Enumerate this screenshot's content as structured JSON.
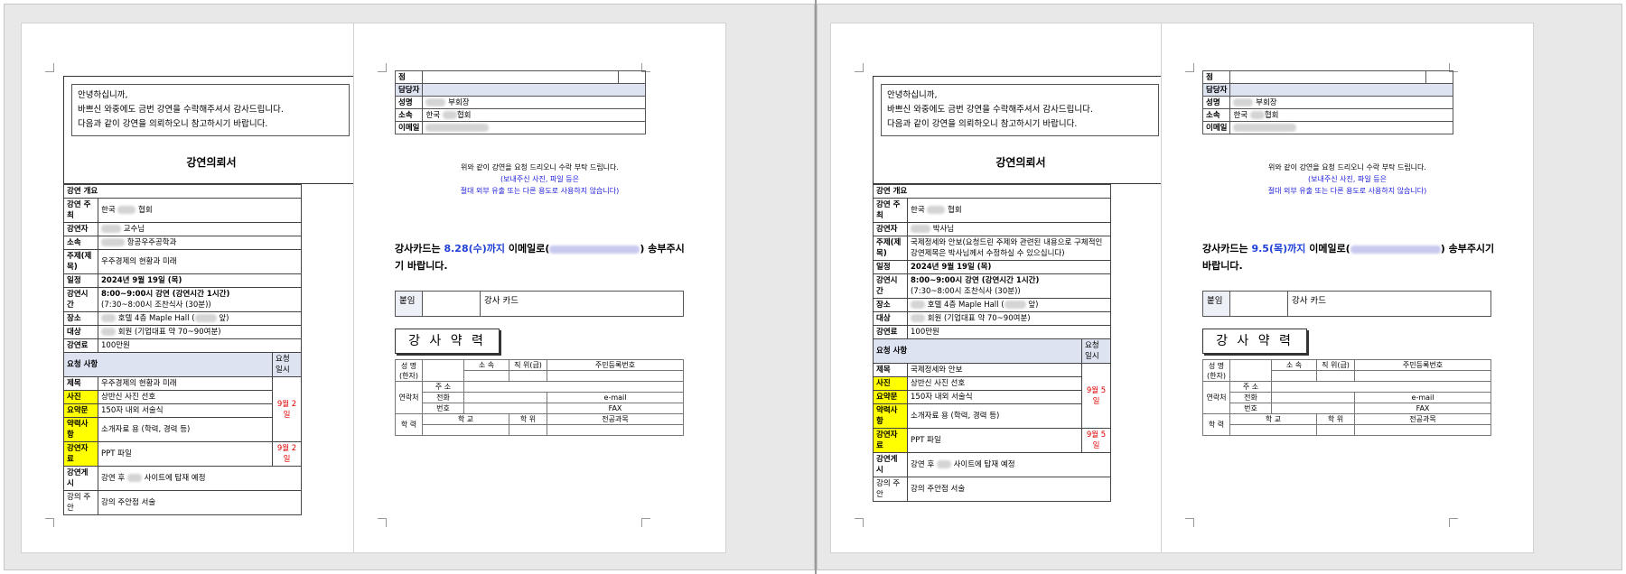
{
  "left_window": {
    "page1": {
      "greeting": [
        "안녕하십니까,",
        "바쁘신 와중에도 금번 강연을 수락해주셔서 감사드립니다.",
        "다음과 같이 강연을 의뢰하오니 참고하시기 바랍니다."
      ],
      "doc_title": "강연의뢰서",
      "overview_label": "강연 개요",
      "host_label": "강연 주최",
      "host_value_prefix": "한국",
      "host_value_suffix": "협회",
      "speaker_label": "강연자",
      "speaker_title": "교수님",
      "affil_label": "소속",
      "affil_value": "항공우주공학과",
      "topic_label": "주제(제목)",
      "topic_value": "우주경제의 현황과 미래",
      "date_label": "일정",
      "date_value": "2024년 9월 19일 (목)",
      "time_label": "강연시간",
      "time_value": "8:00~9:00시 강연 (강연시간 1시간)",
      "time_sub": "(7:30~8:00시 조찬식사 (30분))",
      "place_label": "장소",
      "place_value_a": "호텔 4층 Maple Hall (",
      "place_value_b": "앞)",
      "audience_label": "대상",
      "audience_value": "회원 (기업대표 약 70~90여분)",
      "fee_label": "강연료",
      "fee_value": "100만원",
      "req_label": "요청 사항",
      "req_due_label": "요청 일시",
      "title_label": "제목",
      "title_value": "우주경제의 현황과 미래",
      "photo_label": "사진",
      "photo_value": "상반신 사진 선호",
      "summary_label": "요약문",
      "summary_value": "150자 내외 서술식",
      "bio_label": "약력사항",
      "bio_value": "소개자료 용 (학력, 경력 등)",
      "material_label": "강연자료",
      "material_value": "PPT 파일",
      "posting_label": "강연게시",
      "posting_a": "강연 후",
      "posting_b": "사이트에 탑재 예정",
      "note_label": "강의 주안",
      "note_value": "강의 주안점 서술",
      "due1": "9월 2일",
      "due2": "9월 2일"
    },
    "page2": {
      "rows": [
        "점",
        "담당자",
        "성명",
        "소속",
        "이메일"
      ],
      "name_value": "부회장",
      "affil_a": "한국",
      "affil_b": "협회",
      "req_line1": "위와 같이 강연을 요청 드리오니 수락 부탁 드립니다.",
      "req_line2": "(보내주신 사진, 파일 등은",
      "req_line3": "절대 외부 유출 또는 다른 용도로 사용하지 않습니다)",
      "due_a": "강사카드는",
      "due_date": "8.28(수)까지",
      "due_b": "이메일로(",
      "due_c": ") 송부주시기 바랍니다.",
      "attach_label": "붙임",
      "attach_value": "강사 카드",
      "career_title": "강 사 약 력",
      "c_name": "성 명",
      "c_hanja": "(한자)",
      "c_affil": "소 속",
      "c_pos": "직 위(급)",
      "c_rrn": "주민등록번호",
      "c_contact": "연락처",
      "c_addr": "주 소",
      "c_phone": "전화",
      "c_num": "번호",
      "c_email": "e-mail",
      "c_fax": "FAX",
      "c_edu": "학 력",
      "c_school": "학 교",
      "c_degree": "학 위",
      "c_major": "전공과목"
    }
  },
  "right_window": {
    "page1": {
      "greeting": [
        "안녕하십니까,",
        "바쁘신 와중에도 금번 강연을 수락해주셔서 감사드립니다.",
        "다음과 같이 강연을 의뢰하오니 참고하시기 바랍니다."
      ],
      "doc_title": "강연의뢰서",
      "overview_label": "강연 개요",
      "host_label": "강연 주최",
      "host_value_prefix": "한국",
      "host_value_suffix": "협회",
      "speaker_label": "강연자",
      "speaker_title": "박사님",
      "topic_label": "주제(제목)",
      "topic_value": "국제정세와 안보(요청드린 주제와 관련된 내용으로 구체적인 강연제목은 박사님께서 수정하실 수 있으십니다)",
      "date_label": "일정",
      "date_value": "2024년 9월 19일 (목)",
      "time_label": "강연시간",
      "time_value": "8:00~9:00시 강연 (강연시간 1시간)",
      "time_sub": "(7:30~8:00시 조찬식사 (30분))",
      "place_label": "장소",
      "place_value_a": "호텔 4층 Maple Hall (",
      "place_value_b": "앞)",
      "audience_label": "대상",
      "audience_value": "회원 (기업대표 약 70~90여분)",
      "fee_label": "강연료",
      "fee_value": "100만원",
      "req_label": "요청 사항",
      "req_due_label": "요청 일시",
      "title_label": "제목",
      "title_value": "국제정세와 안보",
      "photo_label": "사진",
      "photo_value": "상반신 사진 선호",
      "summary_label": "요약문",
      "summary_value": "150자 내외 서술식",
      "bio_label": "약력사항",
      "bio_value": "소개자료 용 (학력, 경력 등)",
      "material_label": "강연자료",
      "material_value": "PPT 파일",
      "posting_label": "강연게시",
      "posting_a": "강연 후",
      "posting_b": "사이트에 탑재 예정",
      "note_label": "강의 주안",
      "note_value": "강의 주안점 서술",
      "due1": "9월 5일",
      "due2": "9월 5일"
    },
    "page2": {
      "rows": [
        "점",
        "담당자",
        "성명",
        "소속",
        "이메일"
      ],
      "name_value": "부회장",
      "affil_a": "한국",
      "affil_b": "협회",
      "req_line1": "위와 같이 강연을 요청 드리오니 수락 부탁 드립니다.",
      "req_line2": "(보내주신 사진, 파일 등은",
      "req_line3": "절대 외부 유출 또는 다른 용도로 사용하지 않습니다)",
      "due_a": "강사카드는",
      "due_date": "9.5(목)까지",
      "due_b": "이메일로(",
      "due_c": ") 송부주시기 바랍니다.",
      "attach_label": "붙임",
      "attach_value": "강사 카드",
      "career_title": "강 사 약 력",
      "c_name": "성 명",
      "c_hanja": "(한자)",
      "c_affil": "소 속",
      "c_pos": "직 위(급)",
      "c_rrn": "주민등록번호",
      "c_contact": "연락처",
      "c_addr": "주 소",
      "c_phone": "전화",
      "c_num": "번호",
      "c_email": "e-mail",
      "c_fax": "FAX",
      "c_edu": "학 력",
      "c_school": "학 교",
      "c_degree": "학 위",
      "c_major": "전공과목"
    }
  },
  "colors": {
    "highlight": "#ffff00",
    "due_red": "#e00000",
    "link_blue": "#1a1adb",
    "section_bg": "#dde3f1"
  }
}
